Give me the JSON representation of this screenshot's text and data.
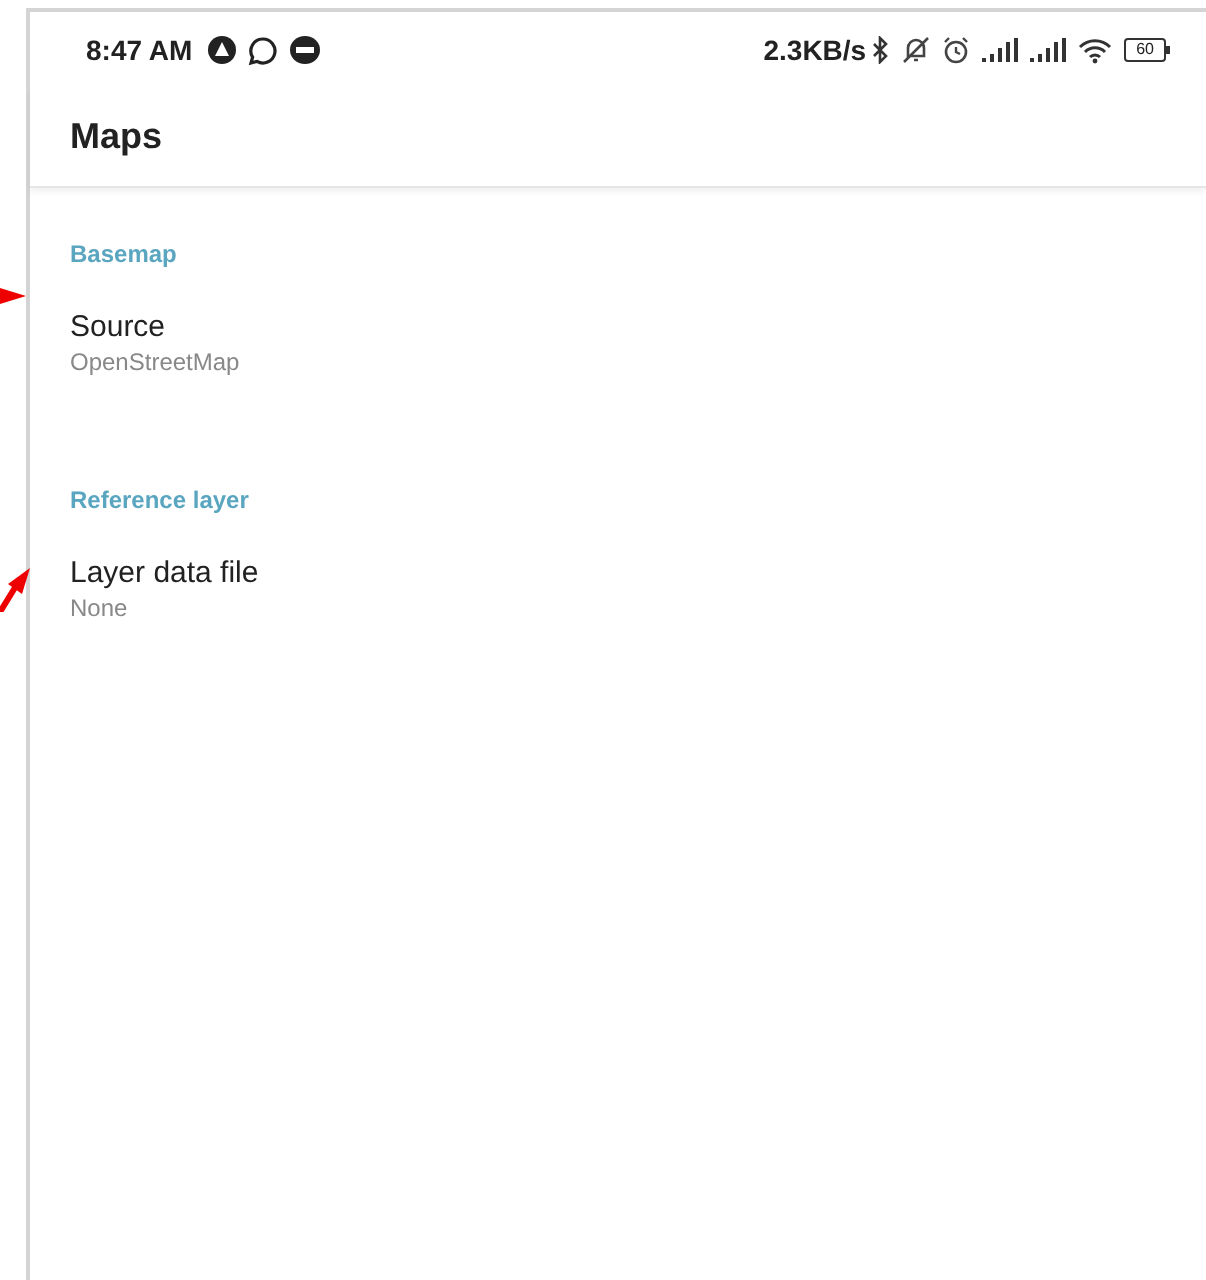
{
  "status_bar": {
    "time": "8:47 AM",
    "speed": "2.3KB/s",
    "battery": "60"
  },
  "app_bar": {
    "title": "Maps"
  },
  "sections": [
    {
      "header": "Basemap",
      "items": [
        {
          "title": "Source",
          "summary": "OpenStreetMap"
        }
      ]
    },
    {
      "header": "Reference layer",
      "items": [
        {
          "title": "Layer data file",
          "summary": "None"
        }
      ]
    }
  ]
}
